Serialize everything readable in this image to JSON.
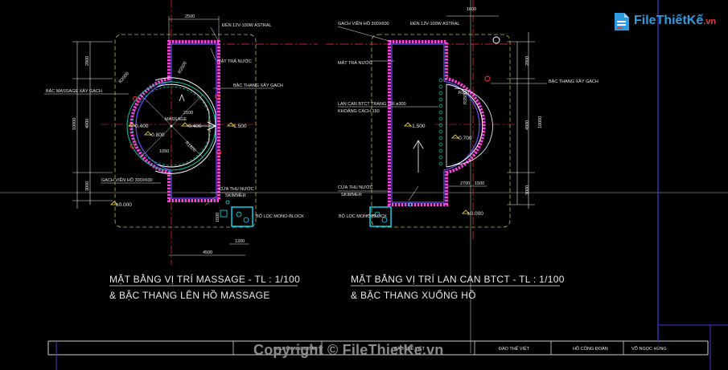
{
  "left_plan": {
    "dim_top": "2500",
    "lamp": "ĐÈN 12V-100W ASTRAL",
    "inlet": "MẶT TRẢ NƯỚC",
    "step_brick": "BẬC THANG XÂY GẠCH",
    "massage_step": "BẬC MASSAGE XÂY GẠCH",
    "massage": "MASSAGE",
    "lvl_0400": "-0.400",
    "lvl_0800": "-0.800",
    "lvl_0400b": "-0.400",
    "lvl_1500": "-1.500",
    "dim_2100": "2100",
    "dim_1050": "1050",
    "dim_r2000": "R2000",
    "dim_r2500": "R2500",
    "dim_r1800": "R1800",
    "tile": "GẠCH VIỀN HỒ 300X600",
    "outlet": "CỬA THU NƯỚC",
    "skimmer": "SKIMMER",
    "lvl_0000": "±0.000",
    "filter": "BỘ LỌC MONO-BLOCK",
    "dim_4500": "4500",
    "dim_1200": "1200",
    "dim_2800": "2800",
    "dim_10000": "10000",
    "dim_4900": "4900",
    "dim_3000": "3000",
    "dim_1600": "1600"
  },
  "right_plan": {
    "tile": "GẠCH VIỀN HỒ 300X600",
    "lamp": "ĐÈN 12V-100W ASTRAL",
    "inlet": "MẶT TRẢ NƯỚC",
    "step_brick": "BẬC THANG XÂY GẠCH",
    "railing": "LAN CAN BTCT TRANG TRÍ ø300",
    "spacing": "KHOẢNG CÁCH 150",
    "lvl_1500": "-1.500",
    "lvl_0700": "-0.700",
    "outlet": "CỬA THU NƯỚC",
    "skimmer": "SKIMMER",
    "filter": "BỘ LỌC MONO-BLOCK",
    "lvl_0000": "±0.000",
    "dim_1600": "1600",
    "dim_2800": "2800",
    "dim_10000": "10000",
    "dim_4900": "4900",
    "dim_3000": "3000",
    "dim_2700": "2700",
    "dim_1500": "1500",
    "dim_r2500": "R2500",
    "dim_r150": "R150"
  },
  "titles": {
    "left_line1": "MẶT BẰNG VỊ TRÍ MASSAGE  - TL : 1/100",
    "left_line2": "& BẬC THANG LÊN HỒ MASSAGE",
    "right_line1": "MẶT BẰNG VỊ TRÍ LAN CAN BTCT  - TL : 1/100",
    "right_line2": "& BẬC THANG XUỐNG HỒ"
  },
  "title_block": {
    "cell1": "NGUYỄN NGỌC BẢO",
    "cell2": "ĐÀO THẾ VIỆT",
    "cell3": "ĐÀO THẾ VIỆT",
    "cell4": "HỒ CÔNG ĐOÀN",
    "cell5": "VÕ NGỌC HÙNG"
  },
  "watermark": {
    "logo_main": "FileThiếtKế",
    "logo_tld": ".vn",
    "copyright": "Copyright © FileThietKe.vn"
  },
  "colors": {
    "background": "#000000",
    "pool_wall": "#6a4cff",
    "tile_border": "#ff3de0",
    "water": "#00c8a8",
    "step": "#ffffff",
    "dimension": "#e8e8e8",
    "center_line": "#ff3030",
    "outline": "#b8b850",
    "cyan": "#00e5ff",
    "yellow": "#ffe14a",
    "blue_frame": "#3b3bd8"
  }
}
